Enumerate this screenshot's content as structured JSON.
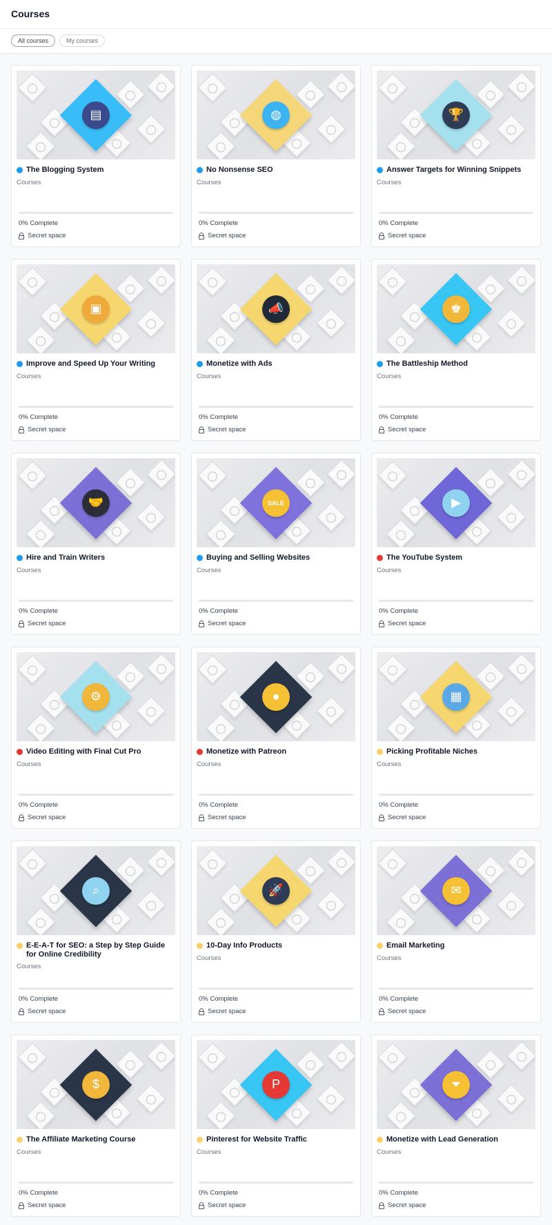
{
  "header": {
    "title": "Courses"
  },
  "tabs": [
    {
      "label": "All courses",
      "active": true
    },
    {
      "label": "My courses",
      "active": false
    }
  ],
  "colors": {
    "blue": "#0ea5e9",
    "red": "#e53935",
    "yellow": "#fbcf6b"
  },
  "courses": [
    {
      "title": "The Blogging System",
      "subtitle": "Courses",
      "progress_text": "0% Complete",
      "progress": 0,
      "privacy": "Secret space",
      "dot_color": "#1f9bf0",
      "diamond_color": "#38bdf8",
      "icon_bg": "#3b4a8c",
      "icon": "document-icon",
      "glyph": "▤"
    },
    {
      "title": "No Nonsense SEO",
      "subtitle": "Courses",
      "progress_text": "0% Complete",
      "progress": 0,
      "privacy": "Secret space",
      "dot_color": "#1f9bf0",
      "diamond_color": "#f5d77a",
      "icon_bg": "#3db4f2",
      "icon": "globe-icon",
      "glyph": "◍"
    },
    {
      "title": "Answer Targets for Winning Snippets",
      "subtitle": "Courses",
      "progress_text": "0% Complete",
      "progress": 0,
      "privacy": "Secret space",
      "dot_color": "#1f9bf0",
      "diamond_color": "#a5e0ee",
      "icon_bg": "#2d3b55",
      "icon": "trophy-icon",
      "glyph": "🏆"
    },
    {
      "title": "Improve and Speed Up Your Writing",
      "subtitle": "Courses",
      "progress_text": "0% Complete",
      "progress": 0,
      "privacy": "Secret space",
      "dot_color": "#1f9bf0",
      "diamond_color": "#f6d66f",
      "icon_bg": "#f0a93b",
      "icon": "image-icon",
      "glyph": "▣"
    },
    {
      "title": "Monetize with Ads",
      "subtitle": "Courses",
      "progress_text": "0% Complete",
      "progress": 0,
      "privacy": "Secret space",
      "dot_color": "#1f9bf0",
      "diamond_color": "#f6d66f",
      "icon_bg": "#1f2937",
      "icon": "megaphone-icon",
      "glyph": "📣"
    },
    {
      "title": "The Battleship Method",
      "subtitle": "Courses",
      "progress_text": "0% Complete",
      "progress": 0,
      "privacy": "Secret space",
      "dot_color": "#1f9bf0",
      "diamond_color": "#38c6f4",
      "icon_bg": "#f0b73b",
      "icon": "chess-piece-icon",
      "glyph": "♚"
    },
    {
      "title": "Hire and Train Writers",
      "subtitle": "Courses",
      "progress_text": "0% Complete",
      "progress": 0,
      "privacy": "Secret space",
      "dot_color": "#1f9bf0",
      "diamond_color": "#7c6fd6",
      "icon_bg": "#2d2d3a",
      "icon": "handshake-icon",
      "glyph": "🤝"
    },
    {
      "title": "Buying and Selling Websites",
      "subtitle": "Courses",
      "progress_text": "0% Complete",
      "progress": 0,
      "privacy": "Secret space",
      "dot_color": "#1f9bf0",
      "diamond_color": "#7f72dc",
      "icon_bg": "#f5c034",
      "icon": "sale-tag-icon",
      "glyph": "SALE"
    },
    {
      "title": "The YouTube System",
      "subtitle": "Courses",
      "progress_text": "0% Complete",
      "progress": 0,
      "privacy": "Secret space",
      "dot_color": "#e53935",
      "diamond_color": "#6f66d8",
      "icon_bg": "#8fd3f0",
      "icon": "play-icon",
      "glyph": "▶"
    },
    {
      "title": "Video Editing with Final Cut Pro",
      "subtitle": "Courses",
      "progress_text": "0% Complete",
      "progress": 0,
      "privacy": "Secret space",
      "dot_color": "#e53935",
      "diamond_color": "#a5e0ee",
      "icon_bg": "#f0b73b",
      "icon": "monitor-gear-icon",
      "glyph": "⚙"
    },
    {
      "title": "Monetize with Patreon",
      "subtitle": "Courses",
      "progress_text": "0% Complete",
      "progress": 0,
      "privacy": "Secret space",
      "dot_color": "#e53935",
      "diamond_color": "#2a3547",
      "icon_bg": "#f5c034",
      "icon": "coin-icon",
      "glyph": "●"
    },
    {
      "title": "Picking Profitable Niches",
      "subtitle": "Courses",
      "progress_text": "0% Complete",
      "progress": 0,
      "privacy": "Secret space",
      "dot_color": "#fbcf6b",
      "diamond_color": "#f6d66f",
      "icon_bg": "#5aa9e6",
      "icon": "presentation-icon",
      "glyph": "▦"
    },
    {
      "title": "E-E-A-T for SEO: a Step by Step Guide for Online Credibility",
      "subtitle": "Courses",
      "progress_text": "0% Complete",
      "progress": 0,
      "privacy": "Secret space",
      "dot_color": "#fbcf6b",
      "diamond_color": "#2a3547",
      "icon_bg": "#8fd3f0",
      "icon": "magnifier-icon",
      "glyph": "⌕"
    },
    {
      "title": "10-Day Info Products",
      "subtitle": "Courses",
      "progress_text": "0% Complete",
      "progress": 0,
      "privacy": "Secret space",
      "dot_color": "#fbcf6b",
      "diamond_color": "#f6d66f",
      "icon_bg": "#2d3b55",
      "icon": "rocket-icon",
      "glyph": "🚀"
    },
    {
      "title": "Email Marketing",
      "subtitle": "Courses",
      "progress_text": "0% Complete",
      "progress": 0,
      "privacy": "Secret space",
      "dot_color": "#fbcf6b",
      "diamond_color": "#7c6fd6",
      "icon_bg": "#f5c034",
      "icon": "envelope-icon",
      "glyph": "✉"
    },
    {
      "title": "The Affiliate Marketing Course",
      "subtitle": "Courses",
      "progress_text": "0% Complete",
      "progress": 0,
      "privacy": "Secret space",
      "dot_color": "#fbcf6b",
      "diamond_color": "#2a3547",
      "icon_bg": "#f0b73b",
      "icon": "person-dollar-icon",
      "glyph": "$"
    },
    {
      "title": "Pinterest for Website Traffic",
      "subtitle": "Courses",
      "progress_text": "0% Complete",
      "progress": 0,
      "privacy": "Secret space",
      "dot_color": "#fbcf6b",
      "diamond_color": "#38c6f4",
      "icon_bg": "#e53935",
      "icon": "pinterest-icon",
      "glyph": "P"
    },
    {
      "title": "Monetize with Lead Generation",
      "subtitle": "Courses",
      "progress_text": "0% Complete",
      "progress": 0,
      "privacy": "Secret space",
      "dot_color": "#fbcf6b",
      "diamond_color": "#7c6fd6",
      "icon_bg": "#f5c034",
      "icon": "funnel-icon",
      "glyph": "⏷"
    }
  ]
}
